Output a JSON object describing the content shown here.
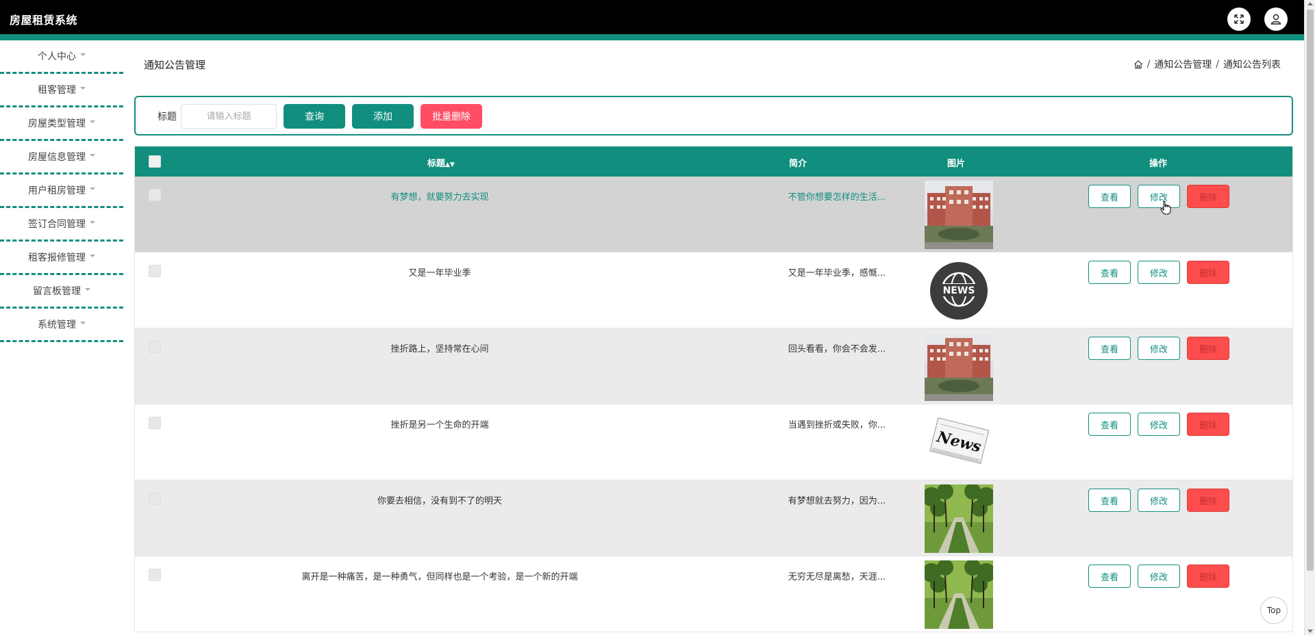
{
  "app": {
    "title": "房屋租赁系统"
  },
  "sidebar": {
    "items": [
      {
        "label": "个人中心"
      },
      {
        "label": "租客管理"
      },
      {
        "label": "房屋类型管理"
      },
      {
        "label": "房屋信息管理"
      },
      {
        "label": "用户租房管理"
      },
      {
        "label": "签订合同管理"
      },
      {
        "label": "租客报修管理"
      },
      {
        "label": "留言板管理"
      },
      {
        "label": "系统管理"
      }
    ]
  },
  "page": {
    "title": "通知公告管理",
    "breadcrumb": [
      "通知公告管理",
      "通知公告列表"
    ],
    "breadcrumb_sep": "/"
  },
  "search": {
    "label": "标题",
    "placeholder": "请输入标题",
    "value": "",
    "query_label": "查询",
    "add_label": "添加",
    "bulk_delete_label": "批量删除"
  },
  "table": {
    "headers": {
      "title": "标题",
      "intro": "简介",
      "image": "图片",
      "actions": "操作"
    },
    "actions": {
      "view": "查看",
      "edit": "修改",
      "delete": "删除"
    },
    "rows": [
      {
        "title": "有梦想，就要努力去实现",
        "intro": "不管你想要怎样的生活...",
        "image": "building-photo"
      },
      {
        "title": "又是一年毕业季",
        "intro": "又是一年毕业季，感慨...",
        "image": "news-globe"
      },
      {
        "title": "挫折路上，坚持常在心间",
        "intro": "回头看看，你会不会发...",
        "image": "building-photo"
      },
      {
        "title": "挫折是另一个生命的开端",
        "intro": "当遇到挫折或失败，你...",
        "image": "news-paper"
      },
      {
        "title": "你要去相信，没有到不了的明天",
        "intro": "有梦想就去努力，因为...",
        "image": "tree-path-photo"
      },
      {
        "title": "离开是一种痛苦，是一种勇气，但同样也是一个考验，是一个新的开端",
        "intro": "无穷无尽是离愁，天涯...",
        "image": "tree-path-photo"
      }
    ]
  },
  "footer": {
    "top_label": "Top"
  },
  "colors": {
    "accent": "#118e7d",
    "danger": "#ff4d4d",
    "header": "#000000"
  }
}
